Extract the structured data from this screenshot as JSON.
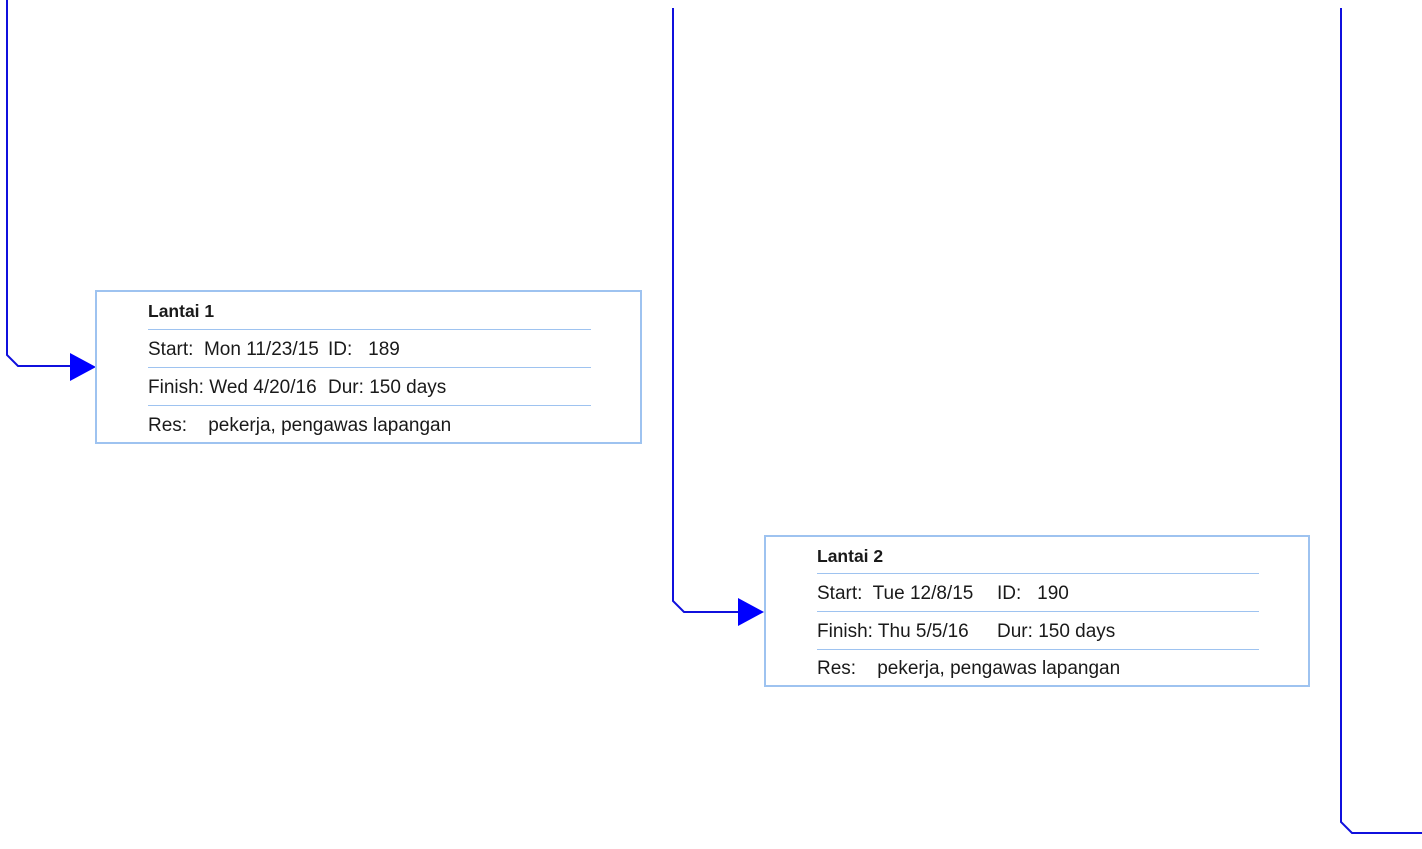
{
  "nodes": [
    {
      "title": "Lantai 1",
      "start_label": "Start:",
      "start_value": "Mon 11/23/15",
      "id_label": "ID:",
      "id_value": "189",
      "finish_label": "Finish:",
      "finish_value": "Wed 4/20/16",
      "dur_label": "Dur:",
      "dur_value": "150 days",
      "res_label": "Res:",
      "res_value": "pekerja, pengawas lapangan"
    },
    {
      "title": "Lantai 2",
      "start_label": "Start:",
      "start_value": "Tue 12/8/15",
      "id_label": "ID:",
      "id_value": "190",
      "finish_label": "Finish:",
      "finish_value": "Thu 5/5/16",
      "dur_label": "Dur:",
      "dur_value": "150 days",
      "res_label": "Res:",
      "res_value": "pekerja, pengawas lapangan"
    }
  ],
  "colors": {
    "link_line": "#1010dd",
    "arrow_head": "#0000ff",
    "box_border": "#9ec3f0",
    "separator": "#9ec3f0",
    "text": "#1a1a1a"
  }
}
